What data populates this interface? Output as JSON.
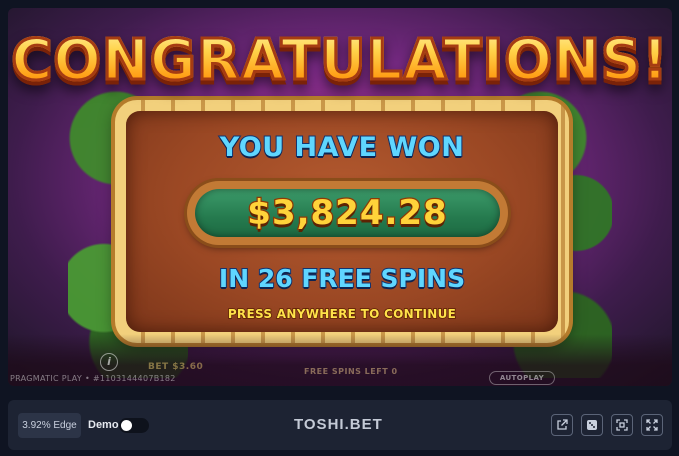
{
  "game": {
    "title": "CONGRATULATIONS!",
    "won_label": "YOU HAVE WON",
    "amount": "$3,824.28",
    "spins_label": "IN 26 FREE SPINS",
    "press_label": "PRESS ANYWHERE TO CONTINUE",
    "bet_text": "BET $3.60",
    "provider_text": "PRAGMATIC PLAY • #1103144407B182",
    "freespins_left_text": "FREE SPINS LEFT 0",
    "autoplay_label": "AUTOPLAY",
    "info_icon": "info-icon"
  },
  "toolbar": {
    "edge_label": "3.92% Edge",
    "demo_label": "Demo",
    "demo_enabled": false,
    "brand": "TOSHI.BET",
    "buttons": [
      {
        "name": "open-external-icon"
      },
      {
        "name": "dice-icon"
      },
      {
        "name": "theater-mode-icon"
      },
      {
        "name": "fullscreen-icon"
      }
    ]
  },
  "colors": {
    "background": "#0f1422",
    "toolbar": "#1d2333",
    "title_gold": "#ffb21e",
    "label_blue": "#5fd6ff",
    "amount_yellow": "#ffd33a",
    "pill_green": "#257a4e"
  }
}
